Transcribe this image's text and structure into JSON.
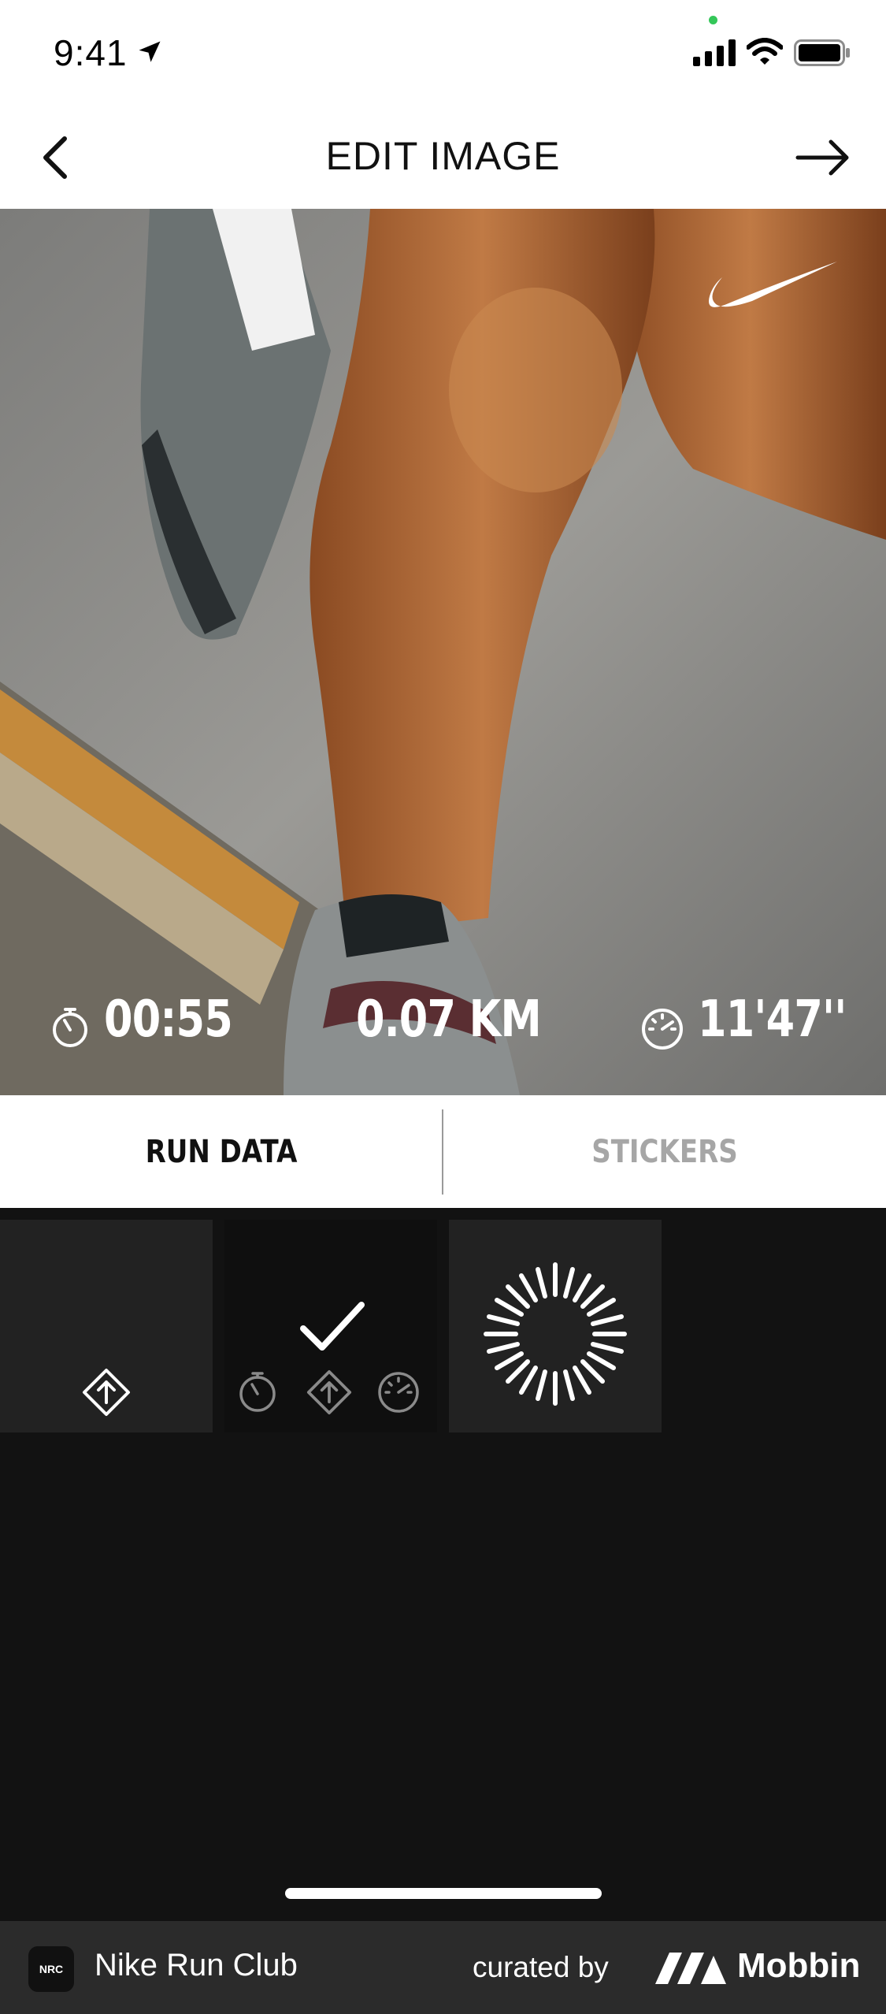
{
  "status_bar": {
    "time": "9:41"
  },
  "nav": {
    "title": "EDIT IMAGE"
  },
  "photo": {
    "stats": {
      "duration": "00:55",
      "distance": "0.07 KM",
      "pace": "11'47''"
    }
  },
  "tabs": [
    {
      "label": "RUN DATA",
      "selected": true
    },
    {
      "label": "STICKERS",
      "selected": false
    }
  ],
  "footer": {
    "app_icon_text": "NRC",
    "app_name": "Nike Run Club",
    "curated_label": "curated by",
    "brand": "Mobbin"
  }
}
